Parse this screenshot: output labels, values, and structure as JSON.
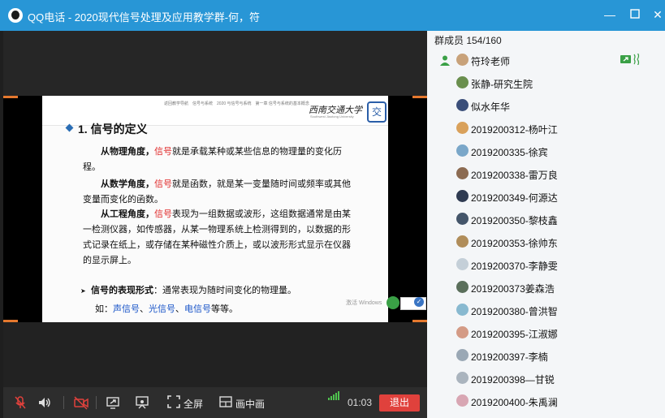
{
  "window": {
    "title": "QQ电话 - 2020现代信号处理及应用教学群-何，符",
    "minimize_label": "—",
    "close_label": "✕",
    "title_icon": "qq-penguin-icon"
  },
  "slide": {
    "nav_text": "返回教学导航　信号与系统　2020 与信号与系统　第一章 信号与系统的基本概念",
    "university_name": "西南交通大学",
    "university_sub": "Southwest Jiaotong University",
    "seal_char": "交",
    "heading": "1. 信号的定义",
    "para1_a": "从物理角度，",
    "para1_red": "信号",
    "para1_b": "就是承载某种或某些信息的物理量的变化历程。",
    "para2_a": "从数学角度，",
    "para2_red": "信号",
    "para2_b": "就是函数，就是某一变量随时间或频率或其他变量而变化的函数。",
    "para3_a": "从工程角度，",
    "para3_red": "信号",
    "para3_b": "表现为一组数据或波形，这组数据通常是由某一检测仪器，如传感器，从某一物理系统上检测得到的，以数据的形式记录在纸上，或存储在某种磁性介质上，或以波形形式显示在仪器的显示屏上。",
    "bullet_a": "信号的表现形式",
    "bullet_b": "：通常表现为随时间变化的物理量。",
    "example_a": "如：",
    "example_s1": "声信号",
    "example_s2": "光信号",
    "example_s3": "电信号",
    "example_sep": "、",
    "example_end": "等等。",
    "watermark": "激活 Windows"
  },
  "toolbar": {
    "fullscreen_label": "全屏",
    "pip_label": "画中画",
    "timer": "01:03",
    "exit_label": "退出",
    "signal_level": 5
  },
  "members": {
    "header": "群成员 154/160",
    "list": [
      {
        "name": "符玲老师"
      },
      {
        "name": "张静-研究生院"
      },
      {
        "name": "似水年华"
      },
      {
        "name": "2019200312-杨叶江"
      },
      {
        "name": "2019200335-徐宾"
      },
      {
        "name": "2019200338-雷万良"
      },
      {
        "name": "2019200349-何源达"
      },
      {
        "name": "2019200350-黎枝鑫"
      },
      {
        "name": "2019200353-徐帅东"
      },
      {
        "name": "2019200370-李静雯"
      },
      {
        "name": "2019200373姜森浩"
      },
      {
        "name": "2019200380-曾洪智"
      },
      {
        "name": "2019200395-江淑娜"
      },
      {
        "name": "2019200397-李楠"
      },
      {
        "name": "2019200398—甘锐"
      },
      {
        "name": "2019200400-朱禹澜"
      }
    ]
  },
  "colors": {
    "titlebar": "#2896d6",
    "accent_orange": "#e5782e",
    "exit_red": "#e0413c",
    "signal_green": "#4fc34f",
    "slide_red": "#e02a2a",
    "slide_blue": "#1a55c8"
  }
}
